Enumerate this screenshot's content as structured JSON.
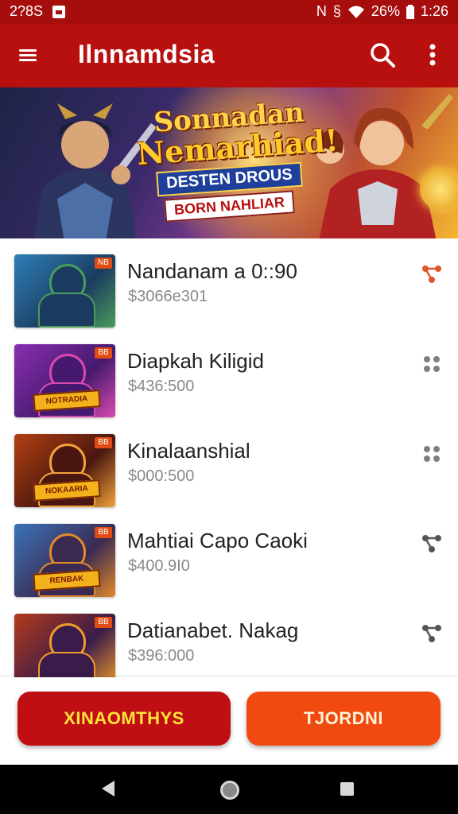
{
  "status_bar": {
    "time_left": "2?8S",
    "battery": "26%",
    "time_right": "1:26",
    "icons": [
      "notification-icon",
      "nfc-icon",
      "data-saver-icon",
      "wifi-icon",
      "battery-icon"
    ]
  },
  "app_bar": {
    "title": "Ilnnamdsia",
    "icons": [
      "menu-icon",
      "search-icon",
      "more-vert-icon"
    ]
  },
  "banner": {
    "line1": "Sonnadan",
    "line2": "Nemarhiad!",
    "line3": "DESTEN DROUS",
    "line4": "BORN NAHLIAR"
  },
  "items": [
    {
      "name": "Nandanam a 0::90",
      "price": "$3066е301",
      "badge": "NB",
      "thumb_tag": "",
      "action_icon": "share-icon",
      "accent": "#e0552a",
      "theme": [
        "#2e7fb8",
        "#1b3c60",
        "#4a9c5a"
      ]
    },
    {
      "name": "Diapkah Kiligid",
      "price": "$436:500",
      "badge": "BB",
      "thumb_tag": "NOTRADIA",
      "action_icon": "dots-grid-icon",
      "accent": "#7f7f7f",
      "theme": [
        "#8a2fb0",
        "#451a6e",
        "#d94ab0"
      ]
    },
    {
      "name": "Kinalaanshial",
      "price": "$000:500",
      "badge": "BB",
      "thumb_tag": "NOKAARIA",
      "action_icon": "dots-grid-icon",
      "accent": "#7f7f7f",
      "theme": [
        "#b24012",
        "#4a1710",
        "#f2a33a"
      ]
    },
    {
      "name": "Mahtiai Capo Caoki",
      "price": "$400.9I0",
      "badge": "BB",
      "thumb_tag": "RENBAK",
      "action_icon": "share-icon",
      "accent": "#555555",
      "theme": [
        "#3b74b8",
        "#3b2a52",
        "#e38a2a"
      ]
    },
    {
      "name": "Datianabet. Nakag",
      "price": "$396:000",
      "badge": "BB",
      "thumb_tag": "",
      "action_icon": "share-icon",
      "accent": "#555555",
      "theme": [
        "#b43a1a",
        "#3a1c4a",
        "#f09a2a"
      ]
    }
  ],
  "buttons": {
    "primary": "XINAOMTHYS",
    "secondary": "TJORDNI"
  },
  "nav": {
    "icons": [
      "back-icon",
      "home-icon",
      "recents-icon"
    ]
  }
}
